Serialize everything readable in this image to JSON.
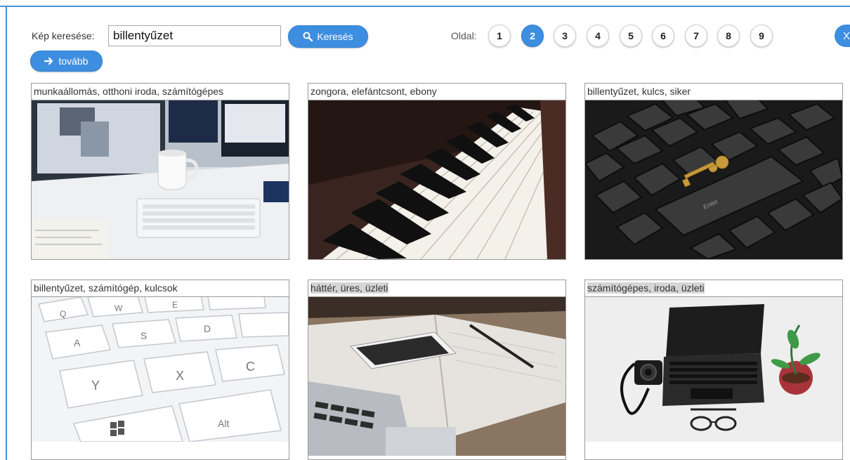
{
  "search": {
    "label": "Kép keresése:",
    "value": "billentyűzet",
    "button_label": "Keresés",
    "more_label": "tovább"
  },
  "pagination": {
    "label": "Oldal:",
    "pages": [
      "1",
      "2",
      "3",
      "4",
      "5",
      "6",
      "7",
      "8",
      "9"
    ],
    "current": "2",
    "close_label": "X"
  },
  "results": [
    {
      "tags": "munkaállomás, otthoni iroda, számítógépes",
      "image": "desk-workstation-photo"
    },
    {
      "tags": "zongora, elefántcsont, ebony",
      "image": "piano-keys-photo"
    },
    {
      "tags": "billentyűzet, kulcs, siker",
      "image": "keyboard-key-photo"
    },
    {
      "tags": "billentyűzet, számítógép, kulcsok",
      "image": "white-keyboard-photo"
    },
    {
      "tags": "háttér, üres, üzleti",
      "image": "notebook-phone-photo"
    },
    {
      "tags": "számítógépes, iroda, üzleti",
      "image": "laptop-camera-photo"
    }
  ],
  "keyboard_photo": {
    "enter_label": "Enter"
  },
  "white_keyboard_photo": {
    "keys": [
      "Q",
      "W",
      "E",
      "A",
      "S",
      "D",
      "Y",
      "X",
      "C",
      "Alt"
    ]
  },
  "colors": {
    "accent": "#3d8ee0",
    "frame": "#4a90d9"
  }
}
